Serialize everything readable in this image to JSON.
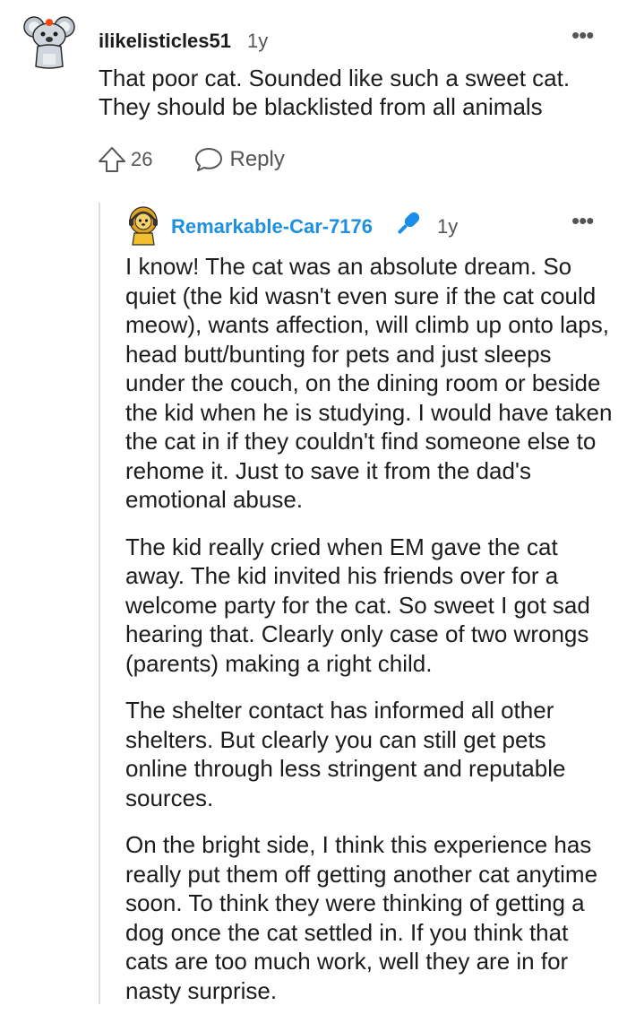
{
  "top_comment": {
    "username": "ilikelisticles51",
    "age": "1y",
    "more_icon": "more-dots-icon",
    "body": [
      "That poor cat. Sounded like such a sweet cat. They should be blacklisted from all animals"
    ],
    "votes": "26",
    "reply_label": "Reply"
  },
  "reply_comment": {
    "username": "Remarkable-Car-7176",
    "username_color": "#1f8fe0",
    "badge_icon": "microphone-icon",
    "age": "1y",
    "more_icon": "more-dots-icon",
    "paragraphs": [
      "I know! The cat was an absolute dream. So quiet (the kid wasn't even sure if the cat could meow), wants affection, will climb up onto laps, head butt/bunting for pets and just sleeps under the couch, on the dining room or beside the kid when he is studying. I would have taken the cat in if they couldn't find someone else to rehome it. Just to save it from the dad's emotional abuse.",
      "The kid really cried when EM gave the cat away. The kid invited his friends over for a welcome party for the cat. So sweet I got sad hearing that. Clearly only case of two wrongs (parents) making a right child.",
      "The shelter contact has informed all other shelters. But clearly you can still get pets online through less stringent and reputable sources.",
      "On the bright side, I think this experience has really put them off getting another cat anytime soon. To think they were thinking of getting a dog once the cat settled in. If you think that cats are too much work, well they are in for nasty surprise."
    ]
  }
}
